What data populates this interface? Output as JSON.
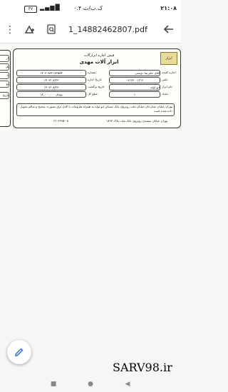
{
  "status_bar": {
    "time": "۲۱:۰۸",
    "network": "۰.۴ ک.ب/ث",
    "battery": "۳۷",
    "signal": "▂▄▆█"
  },
  "toolbar": {
    "file_name": "1_14882462807.pdf",
    "back_icon": "arrow-back-icon",
    "drive_icon": "drive-add-icon",
    "search_icon": "search-doc-icon",
    "more_icon": "more-vert-icon"
  },
  "document": {
    "header_small": "فیش اجاره ابزارآلات",
    "header_title": "ابزار آلات مهدی",
    "logo_text": "ابزار",
    "fields": [
      {
        "label": "اجاره کننده:",
        "value": "آقای علیرضا دوستی"
      },
      {
        "label": "تلفن:",
        "value": "۰۹۱۲۳۰۰۱۲۱۲"
      },
      {
        "label": "نام ابزار:",
        "value": "اتو لوله"
      },
      {
        "label": "تعداد:",
        "value": "۱"
      },
      {
        "label": "شماره:",
        "value": "۱۴۰۳۰۸۳۲۱۷۲۵۵۴"
      },
      {
        "label": "تاریخ اجاره:",
        "value": "۱۴۰۳/۰۸/۲۳"
      },
      {
        "label": "تاریخ برگشت:",
        "value": "۱۴۰۳/۰۸/۲۳"
      },
      {
        "label": "مبلغ کل:",
        "value": "۱۸,۰۰۰,۰۰۰ تومان"
      }
    ],
    "address_note": "تهران خیابان ستارخان خیابان ملت روبروی بانک مسکن اتو لوله به همراه ملزومات با کابل برق بصورت صحیح و سالم تحویل داده شده است",
    "footer_address": "تهران خیابان سعیدی روبروی بانک ملت پلاک ۱۸۹۳",
    "footer_phone": "۰۲۱-۶۶۹۵-۰۸",
    "stub_labels": [
      "ار",
      "تل",
      "نا",
      "تع",
      "تاریخ"
    ]
  },
  "fab": {
    "icon": "edit-pencil-icon"
  },
  "watermark": "SARV98.ir",
  "nav": {
    "back": "◀",
    "home": "●",
    "recents": "■"
  }
}
